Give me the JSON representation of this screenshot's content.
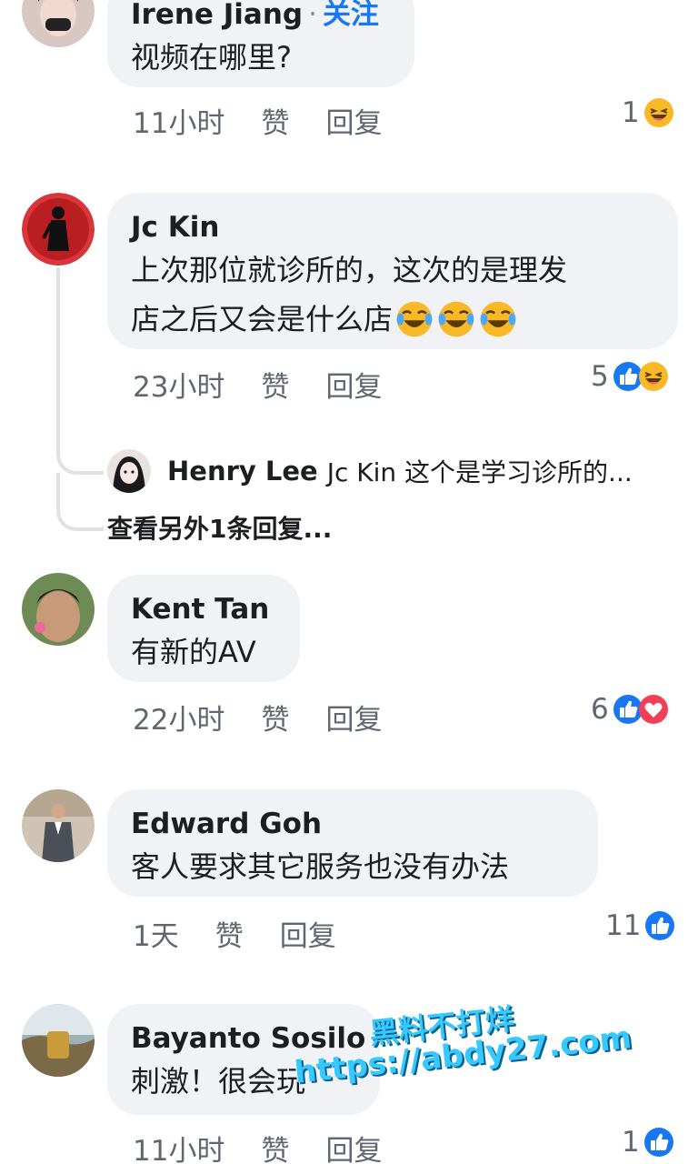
{
  "comments": [
    {
      "author": "Irene Jiang",
      "follow": "关注",
      "text": "视频在哪里?",
      "time": "11小时",
      "like": "赞",
      "reply": "回复",
      "reaction_count": "1",
      "reaction_icons": [
        "haha-icon"
      ]
    },
    {
      "author": "Jc Kin",
      "text_line1": "上次那位就诊所的，这次的是理发",
      "text_line2": "店之后又会是什么店",
      "time": "23小时",
      "like": "赞",
      "reply": "回复",
      "reaction_count": "5",
      "reaction_icons": [
        "like-icon",
        "haha-icon"
      ],
      "thread_reply": {
        "author": "Henry Lee",
        "text": "Jc Kin 这个是学习诊所的..."
      },
      "more_replies": "查看另外1条回复..."
    },
    {
      "author": "Kent Tan",
      "text": "有新的AV",
      "time": "22小时",
      "like": "赞",
      "reply": "回复",
      "reaction_count": "6",
      "reaction_icons": [
        "like-icon",
        "love-icon"
      ]
    },
    {
      "author": "Edward Goh",
      "text": "客人要求其它服务也没有办法",
      "time": "1天",
      "like": "赞",
      "reply": "回复",
      "reaction_count": "11",
      "reaction_icons": [
        "like-icon"
      ]
    },
    {
      "author": "Bayanto Sosilo",
      "text": "刺激！很会玩",
      "time": "11小时",
      "like": "赞",
      "reply": "回复",
      "reaction_count": "1",
      "reaction_icons": [
        "like-icon"
      ]
    }
  ],
  "watermark": {
    "line1": "黑料不打烊",
    "line2": "https://abdy27.com"
  },
  "colors": {
    "bubble": "#f0f2f5",
    "follow": "#1877f2",
    "like": "#1877f2",
    "love": "#f33e58",
    "haha": "#f7b928",
    "meta_text": "#606770"
  }
}
